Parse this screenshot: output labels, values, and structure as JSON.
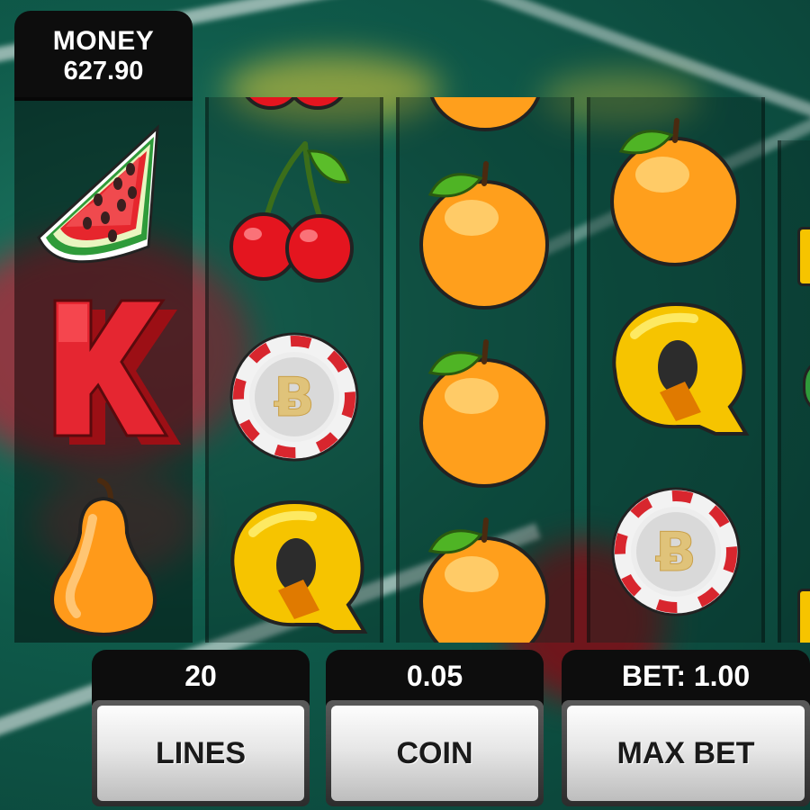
{
  "money": {
    "label": "MONEY",
    "value": "627.90"
  },
  "reels": [
    {
      "symbols": [
        "watermelon-icon",
        "letter-k-icon",
        "pear-icon"
      ]
    },
    {
      "symbols": [
        "cherry-icon",
        "cherry-icon",
        "bitcoin-chip-icon",
        "letter-q-icon"
      ]
    },
    {
      "symbols": [
        "orange-icon",
        "orange-icon",
        "orange-icon",
        "orange-icon"
      ]
    },
    {
      "symbols": [
        "orange-icon",
        "letter-q-icon",
        "bitcoin-chip-icon"
      ]
    },
    {
      "symbols": [
        "letter-w-icon",
        "watermelon-icon",
        "letter-w-icon"
      ]
    }
  ],
  "controls": {
    "lines": {
      "value": "20",
      "label": "LINES"
    },
    "coin": {
      "value": "0.05",
      "label": "COIN"
    },
    "bet": {
      "value": "BET: 1.00",
      "label": "MAX BET"
    }
  },
  "colors": {
    "table_green": "#0f5a4a",
    "panel_black": "#0d0d0d",
    "symbol_yellow": "#ffd21a",
    "symbol_orange": "#ff9f1c",
    "symbol_red": "#e0202a"
  }
}
